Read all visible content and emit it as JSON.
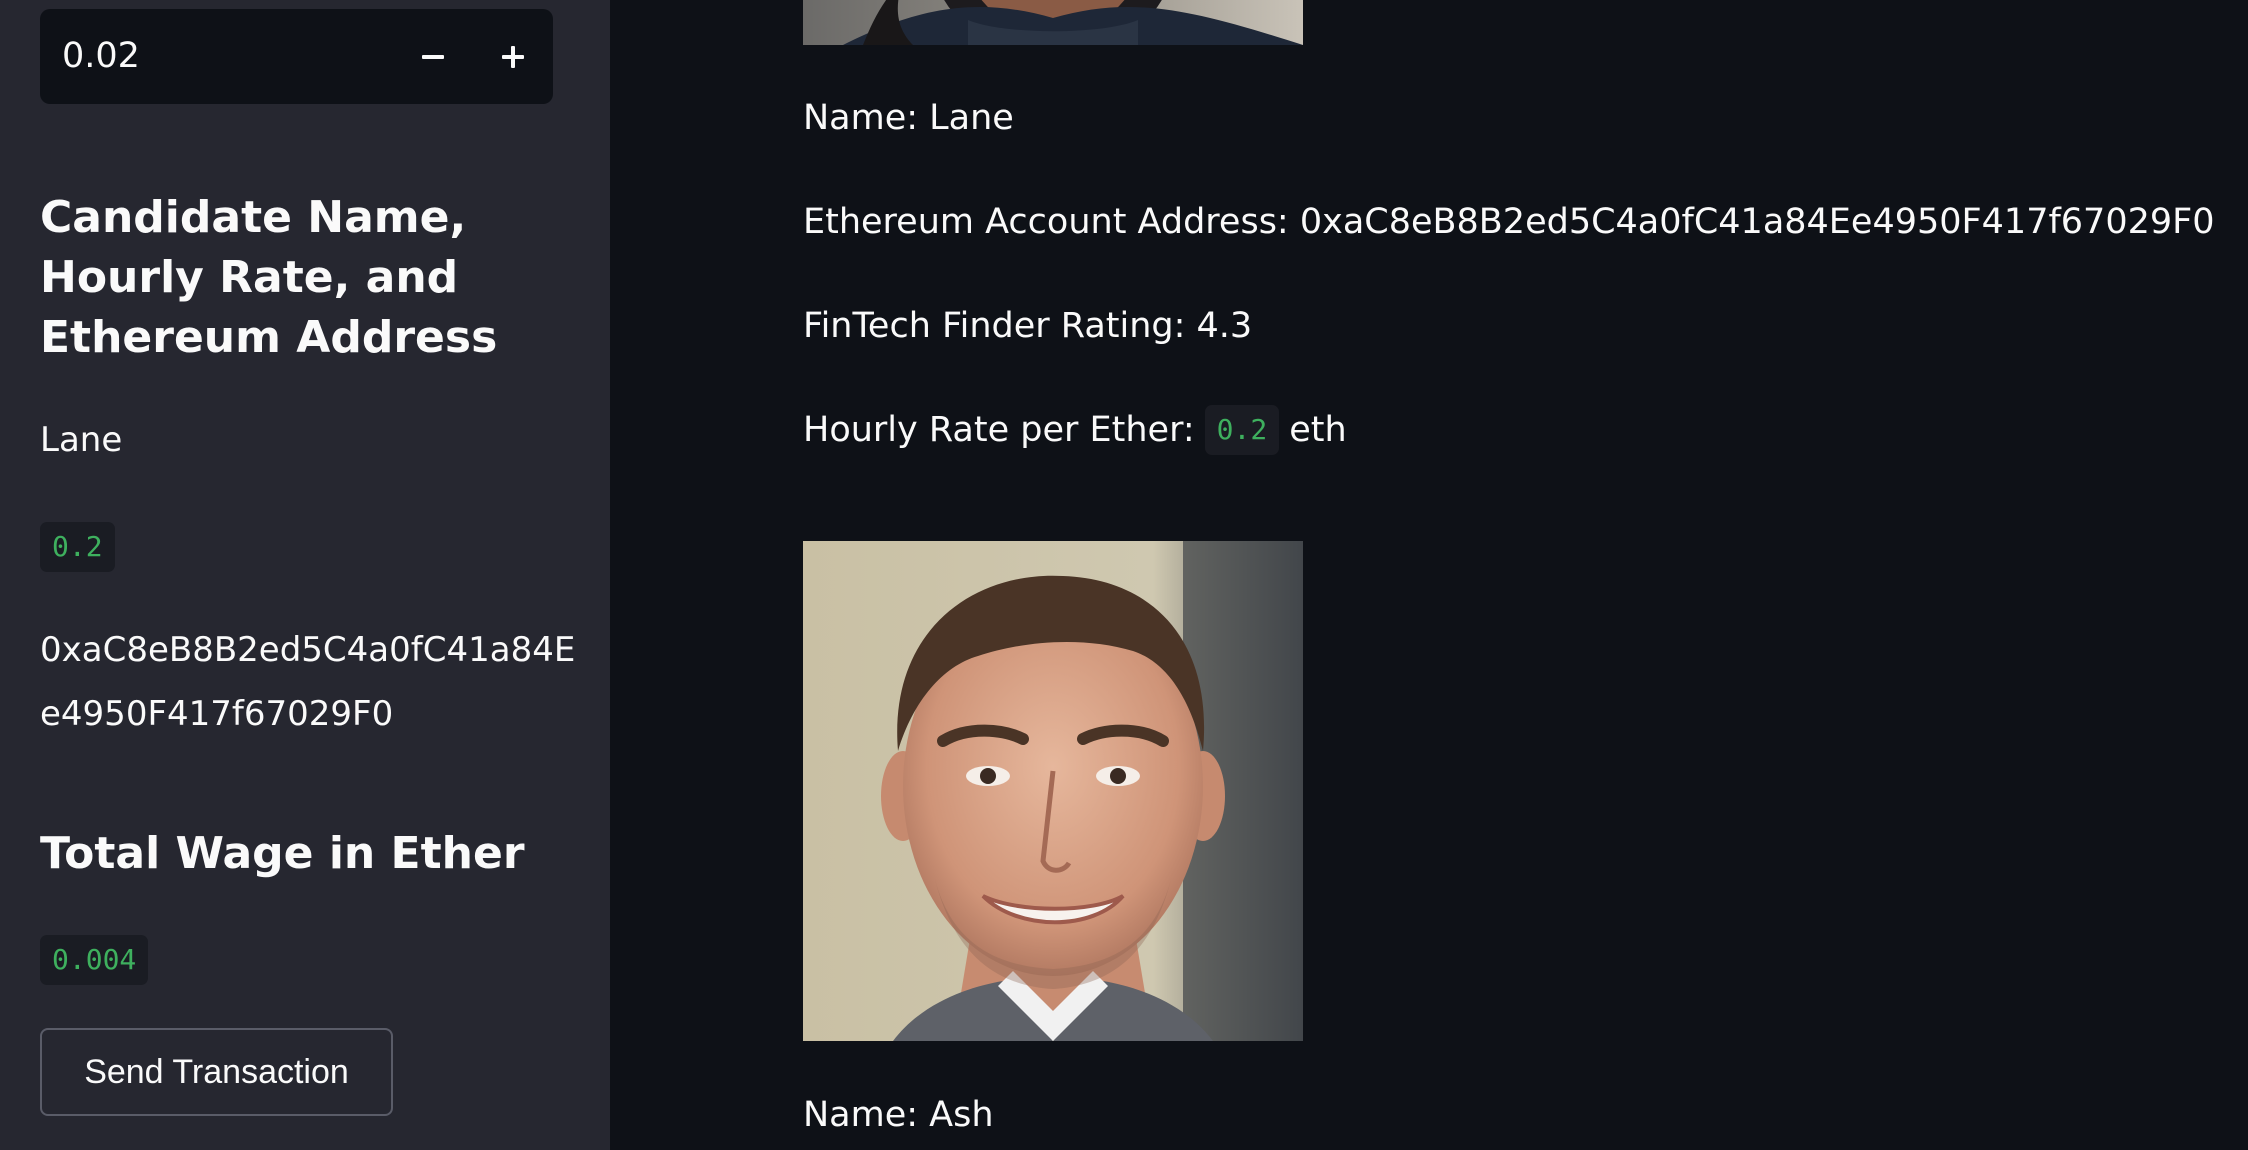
{
  "sidebar": {
    "hours_input": {
      "value": "0.02"
    },
    "candidate_heading": "Candidate Name, Hourly Rate, and Ethereum Address",
    "candidate_name": "Lane",
    "hourly_rate": "0.2",
    "eth_address": "0xaC8eB8B2ed5C4a0fC41a84Ee4950F417f67029F0",
    "wage_heading": "Total Wage in Ether",
    "total_wage": "0.004",
    "send_button_label": "Send Transaction"
  },
  "main": {
    "candidates": [
      {
        "name_line": "Name: Lane",
        "address_line": "Ethereum Account Address: 0xaC8eB8B2ed5C4a0fC41a84Ee4950F417f67029F0",
        "rating_line": "FinTech Finder Rating: 4.3",
        "rate_prefix": "Hourly Rate per Ether:",
        "rate_value": "0.2",
        "rate_suffix": "eth"
      },
      {
        "name_line": "Name: Ash"
      }
    ]
  },
  "colors": {
    "sidebar_bg": "#262730",
    "main_bg": "#0e1117",
    "code_green": "#3eb05e"
  },
  "icons": [
    "minus-icon",
    "plus-icon"
  ]
}
